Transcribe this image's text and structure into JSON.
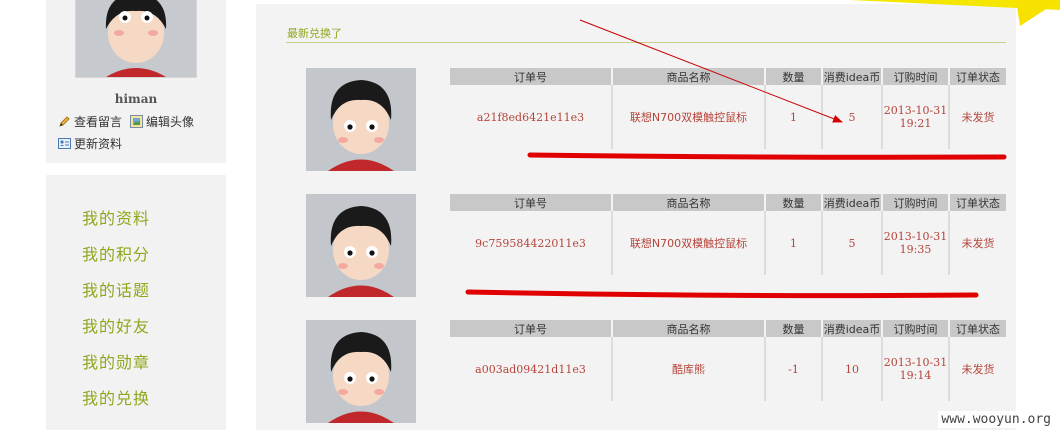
{
  "profile": {
    "name": "himan",
    "links": [
      {
        "label": "查看留言",
        "icon": "pencil-icon"
      },
      {
        "label": "编辑头像",
        "icon": "picture-icon"
      },
      {
        "label": "更新资料",
        "icon": "id-card-icon"
      }
    ]
  },
  "nav": {
    "items": [
      "我的资料",
      "我的积分",
      "我的话题",
      "我的好友",
      "我的勋章",
      "我的兑换"
    ]
  },
  "main": {
    "section_title": "最新兑换了",
    "table_headers": [
      "订单号",
      "商品名称",
      "数量",
      "消费idea币",
      "订购时间",
      "订单状态"
    ],
    "orders": [
      {
        "order_no": "a21f8ed6421e11e3",
        "product": "联想N700双模触控鼠标",
        "qty": "1",
        "cost": "5",
        "date": "2013-10-31",
        "time": "19:21",
        "status": "未发货"
      },
      {
        "order_no": "9c759584422011e3",
        "product": "联想N700双模触控鼠标",
        "qty": "1",
        "cost": "5",
        "date": "2013-10-31",
        "time": "19:35",
        "status": "未发货"
      },
      {
        "order_no": "a003ad09421d11e3",
        "product": "酷库熊",
        "qty": "-1",
        "cost": "10",
        "date": "2013-10-31",
        "time": "19:14",
        "status": "未发货"
      }
    ]
  },
  "watermark": "www.wooyun.org",
  "colors": {
    "accent_green": "#8ea81c",
    "value_red": "#b5443a",
    "annotation_red": "#e00000",
    "corner_yellow": "#f5e600"
  }
}
